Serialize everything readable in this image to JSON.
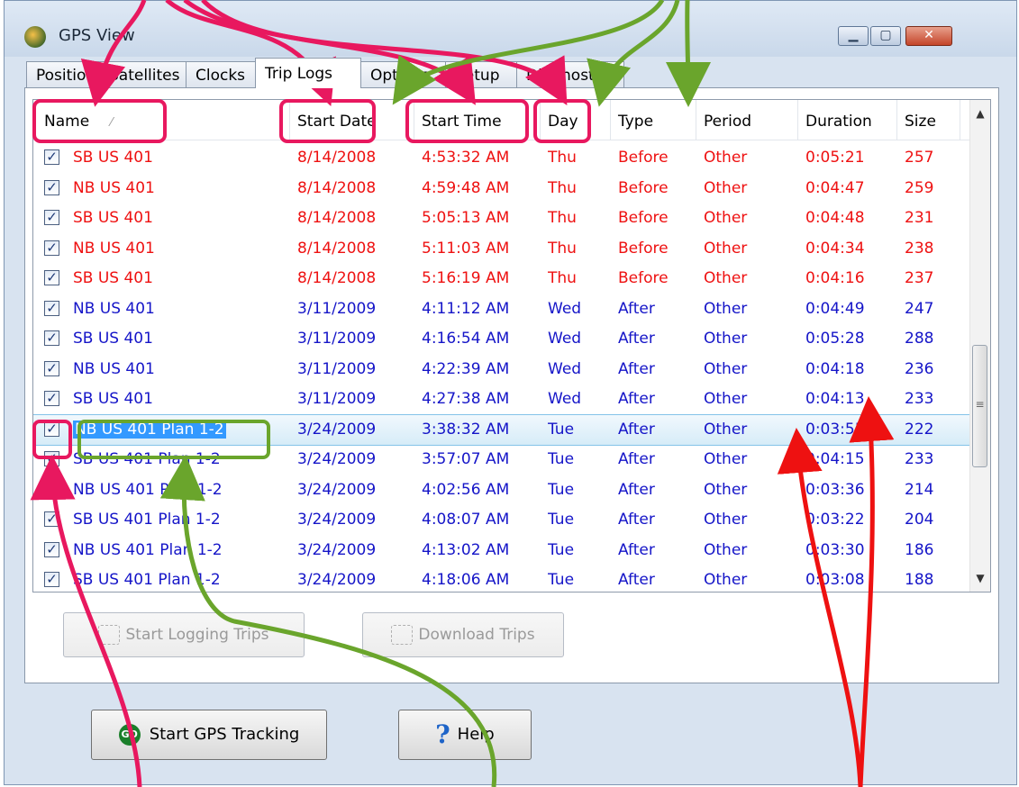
{
  "window": {
    "title": "GPS View",
    "min_glyph": "▁",
    "max_glyph": "▢",
    "close_glyph": "✕"
  },
  "tabs": [
    {
      "label": "Position"
    },
    {
      "label": "Satellites"
    },
    {
      "label": "Clocks"
    },
    {
      "label": "Trip Logs",
      "active": true
    },
    {
      "label": "Options"
    },
    {
      "label": "Setup"
    },
    {
      "label": "Diagnostics"
    }
  ],
  "columns": {
    "name": "Name",
    "sort_glyph": "⁄",
    "start_date": "Start Date",
    "start_time": "Start Time",
    "day": "Day",
    "type": "Type",
    "period": "Period",
    "duration": "Duration",
    "size": "Size"
  },
  "check_glyph": "✓",
  "rows": [
    {
      "name": "SB US 401",
      "date": "8/14/2008",
      "time": "4:53:32 AM",
      "day": "Thu",
      "type": "Before",
      "period": "Other",
      "duration": "0:05:21",
      "size": "257",
      "color": "red"
    },
    {
      "name": "NB US 401",
      "date": "8/14/2008",
      "time": "4:59:48 AM",
      "day": "Thu",
      "type": "Before",
      "period": "Other",
      "duration": "0:04:47",
      "size": "259",
      "color": "red"
    },
    {
      "name": "SB US 401",
      "date": "8/14/2008",
      "time": "5:05:13 AM",
      "day": "Thu",
      "type": "Before",
      "period": "Other",
      "duration": "0:04:48",
      "size": "231",
      "color": "red"
    },
    {
      "name": "NB US 401",
      "date": "8/14/2008",
      "time": "5:11:03 AM",
      "day": "Thu",
      "type": "Before",
      "period": "Other",
      "duration": "0:04:34",
      "size": "238",
      "color": "red"
    },
    {
      "name": "SB US 401",
      "date": "8/14/2008",
      "time": "5:16:19 AM",
      "day": "Thu",
      "type": "Before",
      "period": "Other",
      "duration": "0:04:16",
      "size": "237",
      "color": "red"
    },
    {
      "name": "NB US 401",
      "date": "3/11/2009",
      "time": "4:11:12 AM",
      "day": "Wed",
      "type": "After",
      "period": "Other",
      "duration": "0:04:49",
      "size": "247",
      "color": "blue"
    },
    {
      "name": "SB US 401",
      "date": "3/11/2009",
      "time": "4:16:54 AM",
      "day": "Wed",
      "type": "After",
      "period": "Other",
      "duration": "0:05:28",
      "size": "288",
      "color": "blue"
    },
    {
      "name": "NB US 401",
      "date": "3/11/2009",
      "time": "4:22:39 AM",
      "day": "Wed",
      "type": "After",
      "period": "Other",
      "duration": "0:04:18",
      "size": "236",
      "color": "blue"
    },
    {
      "name": "SB US 401",
      "date": "3/11/2009",
      "time": "4:27:38 AM",
      "day": "Wed",
      "type": "After",
      "period": "Other",
      "duration": "0:04:13",
      "size": "233",
      "color": "blue"
    },
    {
      "name": "NB US 401 Plan 1-2",
      "date": "3/24/2009",
      "time": "3:38:32 AM",
      "day": "Tue",
      "type": "After",
      "period": "Other",
      "duration": "0:03:55",
      "size": "222",
      "color": "blue",
      "selected": true,
      "editing": true
    },
    {
      "name": "SB US 401 Plan 1-2",
      "date": "3/24/2009",
      "time": "3:57:07 AM",
      "day": "Tue",
      "type": "After",
      "period": "Other",
      "duration": "0:04:15",
      "size": "233",
      "color": "blue"
    },
    {
      "name": "NB US 401 Plan 1-2",
      "date": "3/24/2009",
      "time": "4:02:56 AM",
      "day": "Tue",
      "type": "After",
      "period": "Other",
      "duration": "0:03:36",
      "size": "214",
      "color": "blue"
    },
    {
      "name": "SB US 401 Plan 1-2",
      "date": "3/24/2009",
      "time": "4:08:07 AM",
      "day": "Tue",
      "type": "After",
      "period": "Other",
      "duration": "0:03:22",
      "size": "204",
      "color": "blue"
    },
    {
      "name": "NB US 401 Plan 1-2",
      "date": "3/24/2009",
      "time": "4:13:02 AM",
      "day": "Tue",
      "type": "After",
      "period": "Other",
      "duration": "0:03:30",
      "size": "186",
      "color": "blue"
    },
    {
      "name": "SB US 401 Plan 1-2",
      "date": "3/24/2009",
      "time": "4:18:06 AM",
      "day": "Tue",
      "type": "After",
      "period": "Other",
      "duration": "0:03:08",
      "size": "188",
      "color": "blue"
    }
  ],
  "scrollbar": {
    "up_glyph": "▲",
    "down_glyph": "▼",
    "grip_glyph": "≡"
  },
  "buttons": {
    "start_logging": "Start Logging Trips",
    "download": "Download Trips",
    "gps_tracking": "Start GPS Tracking",
    "gps_icon_text": "GO",
    "help": "Help",
    "help_icon_text": "?"
  },
  "colors": {
    "red_text": "#ee1111",
    "blue_text": "#1515c8",
    "callout_pink": "#e8185f",
    "callout_green": "#6aa52c",
    "arrow_red": "#ee1111"
  },
  "icons": [
    "app-globe-icon",
    "minimize-icon",
    "maximize-icon",
    "close-icon",
    "go-icon",
    "help-icon"
  ]
}
